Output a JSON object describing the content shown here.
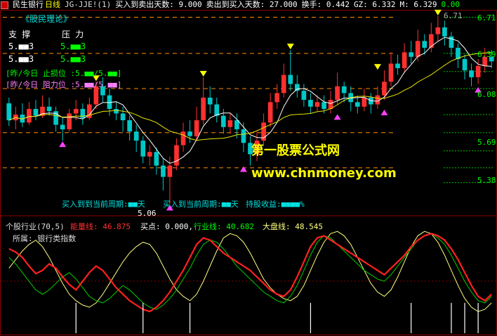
{
  "colors": {
    "up": "#ff3030",
    "down": "#00c8c8",
    "ma_fast": "#ffffff",
    "ma_slow": "#e6e600",
    "support": "#ff8c00",
    "pressure": "#00c000",
    "marker_buy": "#ff40ff",
    "marker_sell": "#ffff00",
    "watermark": "#ffff00",
    "energy": "#ff2020",
    "industry": "#00d000",
    "market": "#ffff80",
    "bars": "#ffffff",
    "axis_red": "#aa0000"
  },
  "header": {
    "stock_name": "民生银行",
    "period": "日线",
    "indicator": "JG-JJE!(1)",
    "buy_to_sell_label": "买入到卖出天数: 9.000",
    "sell_to_buy_label": "卖出到买入天数: 27.000",
    "turnover_label": "换手: 0.442",
    "gz_label": "GZ: 6.332",
    "m_label": "M: 6.329",
    "tail_label": "0.00"
  },
  "main": {
    "theory_title": "《股民理论》",
    "support_label": "支 撑",
    "pressure_label": "压 力",
    "support_val_1": "5.■■3",
    "support_val_2": "5.■■3",
    "pressure_val_1": "5.■■3",
    "pressure_val_2": "5.■■3",
    "stop_loss_label": "[昨/今日 止损位 :5.■■/5.■■]",
    "resistance_label": "[昨/今日 阻力位 :5.■■/5.■■]",
    "price_right_top": "6.71",
    "price_6_71": "6.71",
    "price_6_39": "6.39",
    "price_6_08": "6.08",
    "price_5_69": "5.69",
    "price_5_38": "5.38",
    "low_label": "5.06",
    "period_text": "买入到到当前周期:■■天",
    "overlap_text": "买入到当前周期:■■天",
    "yield_text": "持股收益:■■■■%",
    "watermark_cn": "第一股票公式网",
    "watermark_url": "www.chnmoney.com"
  },
  "sub": {
    "title": "个股行业(70,5)",
    "energy_label": "能量线: 46.875",
    "buy_label": "买点: 0.000,",
    "industry_label": "行业线: 40.682",
    "market_label": "大盘线: 48.545",
    "belong_label": "所属: 银行类指数"
  },
  "chart_data": {
    "type": "candlestick",
    "title": "民生银行 日线",
    "price_levels": [
      6.71,
      6.39,
      6.08,
      5.69,
      5.38
    ],
    "low_mark": 5.06,
    "ylim": [
      5.0,
      6.75
    ],
    "candles": [
      [
        5.95,
        5.8,
        6.0,
        5.75
      ],
      [
        5.8,
        5.85,
        5.92,
        5.72
      ],
      [
        5.85,
        5.78,
        5.95,
        5.74
      ],
      [
        5.78,
        5.9,
        5.96,
        5.76
      ],
      [
        5.9,
        5.84,
        5.98,
        5.8
      ],
      [
        5.84,
        5.92,
        6.02,
        5.82
      ],
      [
        5.92,
        5.88,
        6.0,
        5.84
      ],
      [
        5.88,
        5.76,
        5.92,
        5.7
      ],
      [
        5.76,
        5.72,
        5.82,
        5.62
      ],
      [
        5.72,
        5.86,
        5.9,
        5.7
      ],
      [
        5.86,
        5.9,
        5.98,
        5.8
      ],
      [
        5.9,
        5.82,
        5.95,
        5.76
      ],
      [
        5.82,
        5.94,
        6.0,
        5.8
      ],
      [
        5.94,
        6.1,
        6.14,
        5.9
      ],
      [
        6.1,
        6.02,
        6.18,
        5.96
      ],
      [
        6.02,
        5.9,
        6.08,
        5.84
      ],
      [
        5.9,
        5.86,
        5.96,
        5.8
      ],
      [
        5.86,
        5.8,
        5.92,
        5.7
      ],
      [
        5.8,
        5.7,
        5.84,
        5.62
      ],
      [
        5.7,
        5.62,
        5.76,
        5.52
      ],
      [
        5.62,
        5.48,
        5.66,
        5.42
      ],
      [
        5.48,
        5.52,
        5.58,
        5.4
      ],
      [
        5.52,
        5.4,
        5.56,
        5.32
      ],
      [
        5.4,
        5.3,
        5.46,
        5.18
      ],
      [
        5.3,
        5.4,
        5.48,
        5.06
      ],
      [
        5.4,
        5.58,
        5.64,
        5.36
      ],
      [
        5.58,
        5.7,
        5.78,
        5.52
      ],
      [
        5.7,
        5.66,
        5.8,
        5.6
      ],
      [
        5.66,
        5.8,
        5.92,
        5.62
      ],
      [
        5.8,
        6.0,
        6.18,
        5.76
      ],
      [
        6.0,
        5.94,
        6.1,
        5.86
      ],
      [
        5.94,
        5.84,
        6.0,
        5.78
      ],
      [
        5.84,
        5.74,
        5.9,
        5.68
      ],
      [
        5.74,
        5.8,
        5.86,
        5.68
      ],
      [
        5.8,
        5.72,
        5.86,
        5.64
      ],
      [
        5.72,
        5.6,
        5.78,
        5.52
      ],
      [
        5.6,
        5.5,
        5.66,
        5.4
      ],
      [
        5.5,
        5.62,
        5.7,
        5.44
      ],
      [
        5.62,
        5.78,
        5.86,
        5.58
      ],
      [
        5.78,
        5.96,
        6.04,
        5.74
      ],
      [
        5.96,
        6.04,
        6.12,
        5.9
      ],
      [
        6.04,
        6.2,
        6.3,
        6.0
      ],
      [
        6.2,
        6.12,
        6.42,
        6.06
      ],
      [
        6.12,
        6.06,
        6.2,
        6.0
      ],
      [
        6.06,
        5.98,
        6.12,
        5.92
      ],
      [
        5.98,
        5.92,
        6.04,
        5.86
      ],
      [
        5.92,
        5.96,
        6.02,
        5.88
      ],
      [
        5.96,
        5.9,
        6.02,
        5.86
      ],
      [
        5.9,
        5.98,
        6.06,
        5.86
      ],
      [
        5.98,
        6.1,
        6.22,
        5.94
      ],
      [
        6.1,
        6.04,
        6.14,
        5.96
      ],
      [
        6.04,
        5.96,
        6.1,
        5.88
      ],
      [
        5.96,
        5.92,
        6.02,
        5.86
      ],
      [
        5.92,
        6.0,
        6.08,
        5.88
      ],
      [
        6.0,
        5.94,
        6.04,
        5.86
      ],
      [
        5.94,
        6.02,
        6.1,
        5.9
      ],
      [
        6.02,
        6.14,
        6.24,
        5.98
      ],
      [
        6.14,
        6.3,
        6.4,
        6.1
      ],
      [
        6.3,
        6.26,
        6.38,
        6.2
      ],
      [
        6.26,
        6.4,
        6.48,
        6.22
      ],
      [
        6.4,
        6.36,
        6.5,
        6.3
      ],
      [
        6.36,
        6.5,
        6.6,
        6.32
      ],
      [
        6.5,
        6.44,
        6.56,
        6.38
      ],
      [
        6.44,
        6.56,
        6.66,
        6.4
      ],
      [
        6.56,
        6.62,
        6.72,
        6.5
      ],
      [
        6.62,
        6.54,
        6.68,
        6.46
      ],
      [
        6.54,
        6.44,
        6.58,
        6.36
      ],
      [
        6.44,
        6.34,
        6.48,
        6.26
      ],
      [
        6.34,
        6.24,
        6.38,
        6.16
      ],
      [
        6.24,
        6.18,
        6.3,
        6.1
      ],
      [
        6.18,
        6.28,
        6.34,
        6.12
      ],
      [
        6.28,
        6.36,
        6.44,
        6.22
      ],
      [
        6.36,
        6.32,
        6.42,
        6.26
      ]
    ],
    "sub_energy": [
      78,
      75,
      70,
      62,
      55,
      58,
      64,
      60,
      52,
      45,
      40,
      48,
      56,
      62,
      58,
      50,
      42,
      36,
      30,
      26,
      22,
      20,
      24,
      30,
      38,
      48,
      58,
      70,
      82,
      88,
      86,
      80,
      74,
      70,
      66,
      62,
      58,
      52,
      46,
      40,
      36,
      34,
      40,
      52,
      66,
      80,
      88,
      90,
      86,
      82,
      78,
      74,
      70,
      66,
      62,
      58,
      54,
      60,
      66,
      72,
      80,
      86,
      90,
      92,
      90,
      86,
      78,
      68,
      56,
      44,
      34,
      30,
      36
    ],
    "sub_industry": [
      70,
      64,
      56,
      48,
      40,
      36,
      40,
      46,
      52,
      56,
      50,
      42,
      34,
      30,
      28,
      32,
      38,
      44,
      40,
      34,
      28,
      24,
      22,
      26,
      32,
      40,
      50,
      60,
      72,
      82,
      86,
      84,
      78,
      70,
      62,
      56,
      50,
      44,
      38,
      34,
      30,
      28,
      34,
      44,
      58,
      72,
      84,
      90,
      88,
      82,
      76,
      70,
      64,
      58,
      54,
      50,
      48,
      54,
      62,
      70,
      78,
      86,
      90,
      92,
      88,
      82,
      72,
      60,
      48,
      38,
      30,
      28,
      34
    ],
    "sub_market": [
      60,
      68,
      76,
      82,
      86,
      80,
      70,
      58,
      46,
      36,
      30,
      26,
      24,
      28,
      36,
      46,
      56,
      66,
      74,
      80,
      84,
      82,
      74,
      62,
      50,
      40,
      34,
      30,
      36,
      48,
      62,
      76,
      88,
      92,
      90,
      84,
      74,
      62,
      50,
      42,
      36,
      32,
      30,
      34,
      44,
      58,
      72,
      84,
      92,
      94,
      90,
      82,
      70,
      58,
      46,
      38,
      34,
      40,
      52,
      66,
      80,
      90,
      94,
      92,
      84,
      72,
      58,
      44,
      32,
      24,
      20,
      22,
      28
    ]
  }
}
